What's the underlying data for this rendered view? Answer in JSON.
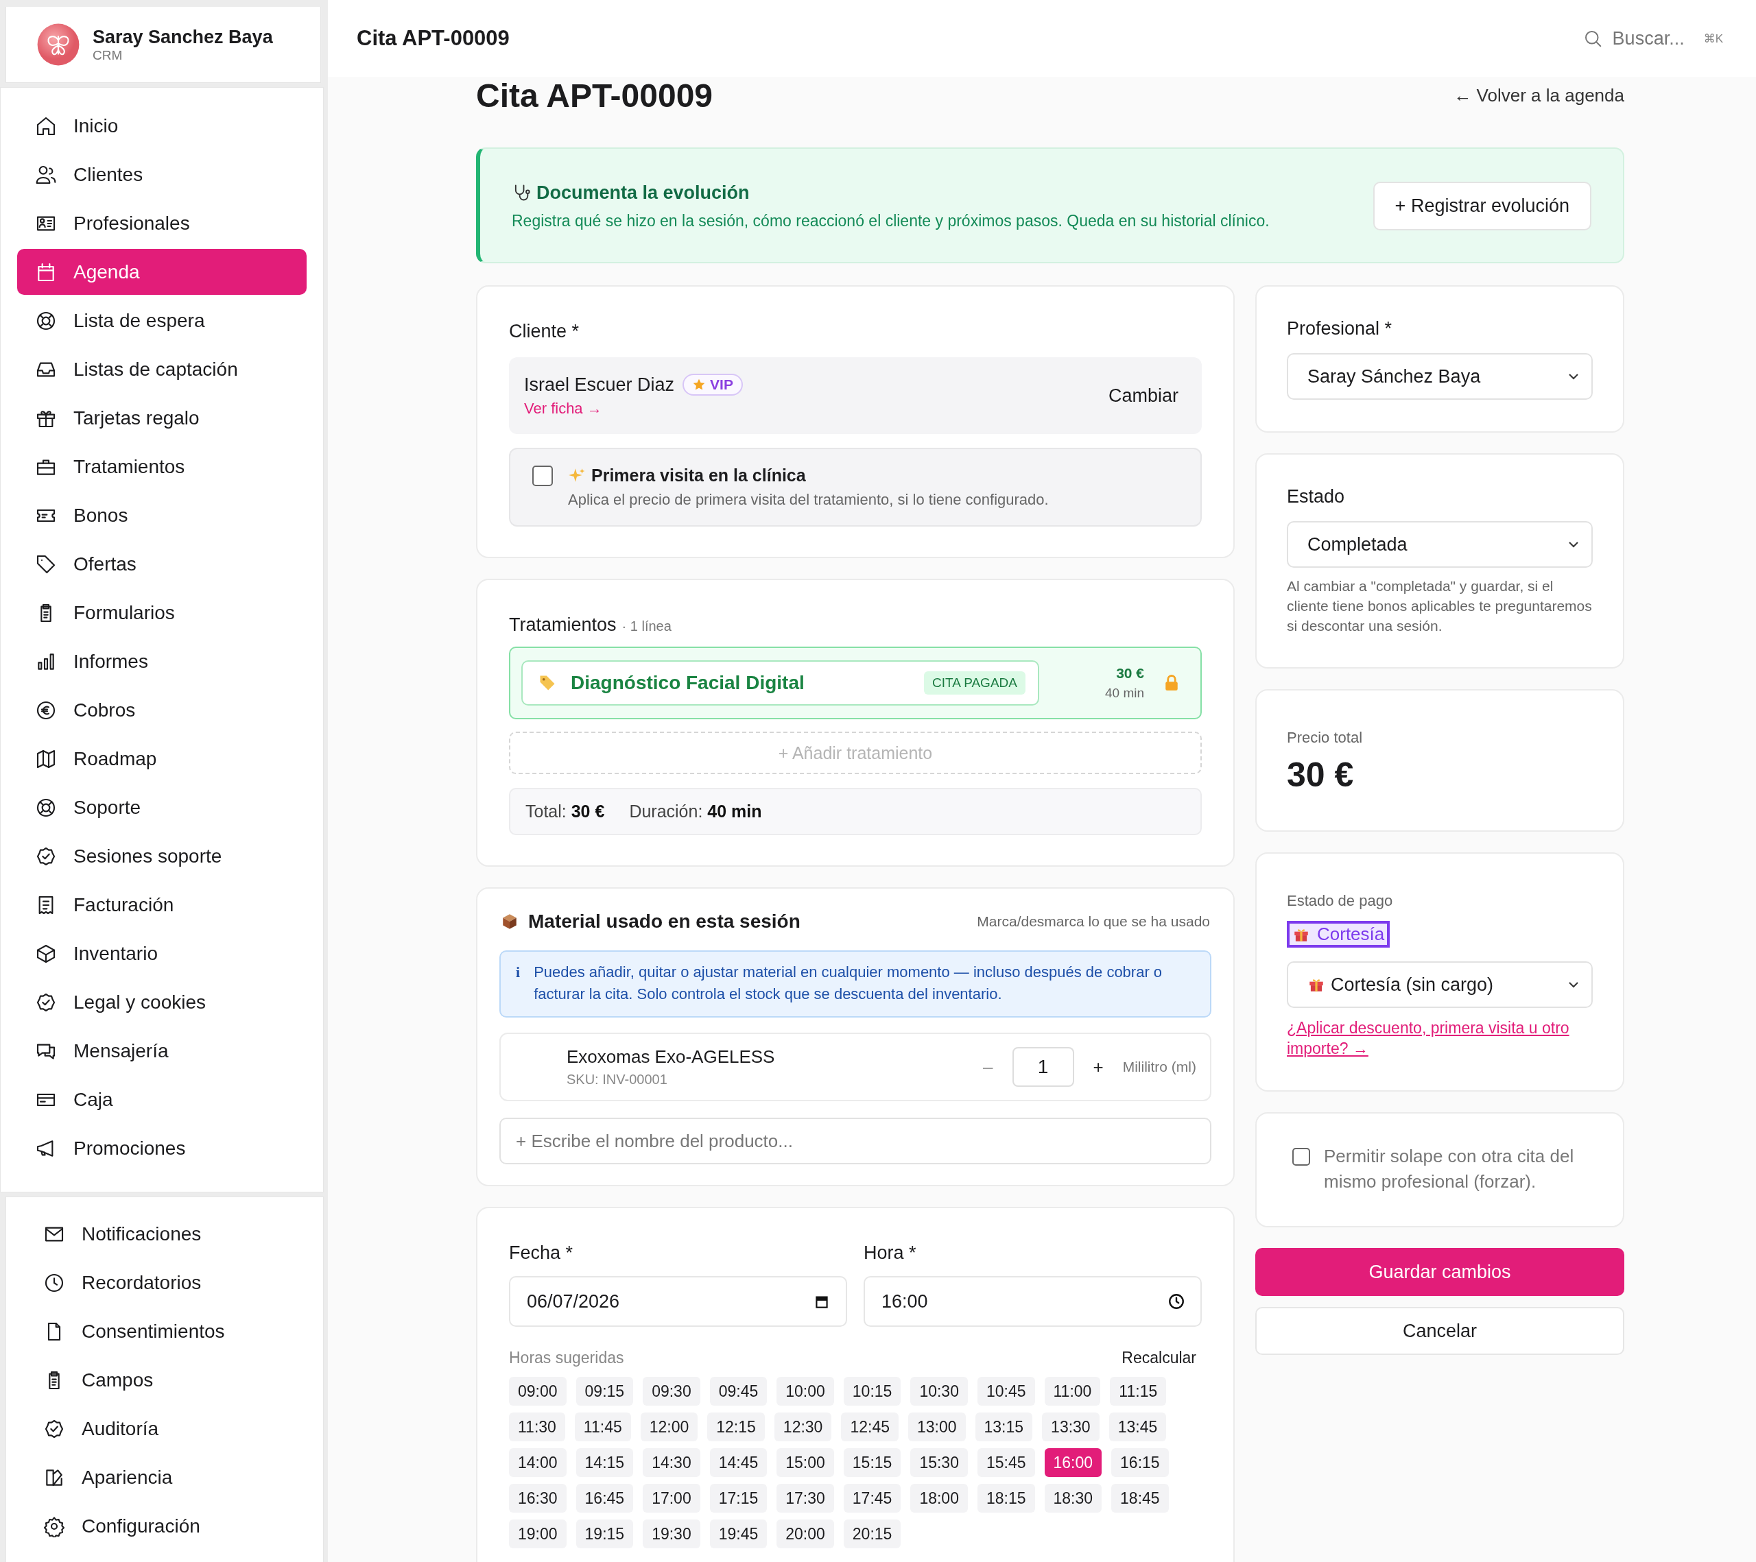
{
  "sidebar": {
    "brand": {
      "name": "Saray Sanchez Baya",
      "subtitle": "CRM"
    },
    "items": [
      {
        "label": "Inicio",
        "selected": false
      },
      {
        "label": "Clientes",
        "selected": false
      },
      {
        "label": "Profesionales",
        "selected": false
      },
      {
        "label": "Agenda",
        "selected": true
      },
      {
        "label": "Lista de espera",
        "selected": false
      },
      {
        "label": "Listas de captación",
        "selected": false
      },
      {
        "label": "Tarjetas regalo",
        "selected": false
      },
      {
        "label": "Tratamientos",
        "selected": false
      },
      {
        "label": "Bonos",
        "selected": false
      },
      {
        "label": "Ofertas",
        "selected": false
      },
      {
        "label": "Formularios",
        "selected": false
      },
      {
        "label": "Informes",
        "selected": false
      },
      {
        "label": "Cobros",
        "selected": false
      },
      {
        "label": "Roadmap",
        "selected": false
      },
      {
        "label": "Soporte",
        "selected": false
      },
      {
        "label": "Sesiones soporte",
        "selected": false
      },
      {
        "label": "Facturación",
        "selected": false
      },
      {
        "label": "Inventario",
        "selected": false
      },
      {
        "label": "Legal y cookies",
        "selected": false
      },
      {
        "label": "Mensajería",
        "selected": false
      },
      {
        "label": "Caja",
        "selected": false
      },
      {
        "label": "Promociones",
        "selected": false
      }
    ],
    "footer_items": [
      {
        "label": "Notificaciones",
        "selected": false
      },
      {
        "label": "Recordatorios",
        "selected": false
      },
      {
        "label": "Consentimientos",
        "selected": false
      },
      {
        "label": "Campos",
        "selected": false
      },
      {
        "label": "Auditoría",
        "selected": false
      },
      {
        "label": "Apariencia",
        "selected": false
      },
      {
        "label": "Configuración",
        "selected": false
      }
    ]
  },
  "header": {
    "title": "Cita APT-00009",
    "search_placeholder": "Buscar...",
    "shortcut": "⌘K"
  },
  "page": {
    "title": "Cita APT-00009",
    "back_link": "← Volver a la agenda"
  },
  "banner": {
    "title": "Documenta la evolución",
    "text": "Registra qué se hizo en la sesión, cómo reaccionó el cliente y próximos pasos. Queda en su historial clínico.",
    "button": "+ Registrar evolución"
  },
  "client": {
    "label": "Cliente *",
    "name": "Israel Escuer Diaz",
    "badge": "VIP",
    "link": "Ver ficha →",
    "change_button": "Cambiar",
    "first_visit": {
      "label": "Primera visita en la clínica",
      "hint": "Aplica el precio de primera visita del tratamiento, si lo tiene configurado.",
      "checked": false
    }
  },
  "treatments": {
    "title": "Tratamientos",
    "count": "· 1 línea",
    "items": [
      {
        "name": "Diagnóstico Facial Digital",
        "status": "CITA PAGADA",
        "price": "30 €",
        "duration": "40 min",
        "locked": true
      }
    ],
    "add_button": "+ Añadir tratamiento",
    "total_label": "Total:",
    "total": "30 €",
    "duration_label": "Duración:",
    "duration": "40 min"
  },
  "material": {
    "title": "Material usado en esta sesión",
    "hint": "Marca/desmarca lo que se ha usado",
    "info_icon": "i",
    "info": "Puedes añadir, quitar o ajustar material en cualquier momento — incluso después de cobrar o facturar la cita. Solo controla el stock que se descuenta del inventario.",
    "items": [
      {
        "name": "Exoxomas Exo-AGELESS",
        "sku": "SKU: INV-00001",
        "minus": "–",
        "quantity": "1",
        "plus": "+",
        "unit": "Mililitro (ml)"
      }
    ],
    "search_placeholder": "+ Escribe el nombre del producto..."
  },
  "schedule": {
    "date_label": "Fecha *",
    "date": "06/07/2026",
    "time_label": "Hora *",
    "time": "16:00",
    "suggested_label": "Horas sugeridas",
    "recalc": "Recalcular",
    "slots": [
      {
        "time": "09:00",
        "selected": false
      },
      {
        "time": "09:15",
        "selected": false
      },
      {
        "time": "09:30",
        "selected": false
      },
      {
        "time": "09:45",
        "selected": false
      },
      {
        "time": "10:00",
        "selected": false
      },
      {
        "time": "10:15",
        "selected": false
      },
      {
        "time": "10:30",
        "selected": false
      },
      {
        "time": "10:45",
        "selected": false
      },
      {
        "time": "11:00",
        "selected": false
      },
      {
        "time": "11:15",
        "selected": false
      },
      {
        "time": "11:30",
        "selected": false
      },
      {
        "time": "11:45",
        "selected": false
      },
      {
        "time": "12:00",
        "selected": false
      },
      {
        "time": "12:15",
        "selected": false
      },
      {
        "time": "12:30",
        "selected": false
      },
      {
        "time": "12:45",
        "selected": false
      },
      {
        "time": "13:00",
        "selected": false
      },
      {
        "time": "13:15",
        "selected": false
      },
      {
        "time": "13:30",
        "selected": false
      },
      {
        "time": "13:45",
        "selected": false
      },
      {
        "time": "14:00",
        "selected": false
      },
      {
        "time": "14:15",
        "selected": false
      },
      {
        "time": "14:30",
        "selected": false
      },
      {
        "time": "14:45",
        "selected": false
      },
      {
        "time": "15:00",
        "selected": false
      },
      {
        "time": "15:15",
        "selected": false
      },
      {
        "time": "15:30",
        "selected": false
      },
      {
        "time": "15:45",
        "selected": false
      },
      {
        "time": "16:00",
        "selected": true
      },
      {
        "time": "16:15",
        "selected": false
      },
      {
        "time": "16:30",
        "selected": false
      },
      {
        "time": "16:45",
        "selected": false
      },
      {
        "time": "17:00",
        "selected": false
      },
      {
        "time": "17:15",
        "selected": false
      },
      {
        "time": "17:30",
        "selected": false
      },
      {
        "time": "17:45",
        "selected": false
      },
      {
        "time": "18:00",
        "selected": false
      },
      {
        "time": "18:15",
        "selected": false
      },
      {
        "time": "18:30",
        "selected": false
      },
      {
        "time": "18:45",
        "selected": false
      },
      {
        "time": "19:00",
        "selected": false
      },
      {
        "time": "19:15",
        "selected": false
      },
      {
        "time": "19:30",
        "selected": false
      },
      {
        "time": "19:45",
        "selected": false
      },
      {
        "time": "20:00",
        "selected": false
      },
      {
        "time": "20:15",
        "selected": false
      }
    ]
  },
  "professional": {
    "label": "Profesional *",
    "value": "Saray Sánchez Baya"
  },
  "status": {
    "label": "Estado",
    "value": "Completada",
    "hint": "Al cambiar a \"completada\" y guardar, si el cliente tiene bonos aplicables te preguntaremos si descontar una sesión."
  },
  "price": {
    "label": "Precio total",
    "value": "30 €"
  },
  "payment": {
    "label": "Estado de pago",
    "badge": "Cortesía",
    "value": "Cortesía (sin cargo)",
    "link": "¿Aplicar descuento, primera visita u otro importe? →"
  },
  "overlap": {
    "label": "Permitir solape con otra cita del mismo profesional (forzar).",
    "checked": false
  },
  "actions": {
    "save": "Guardar cambios",
    "cancel": "Cancelar"
  }
}
